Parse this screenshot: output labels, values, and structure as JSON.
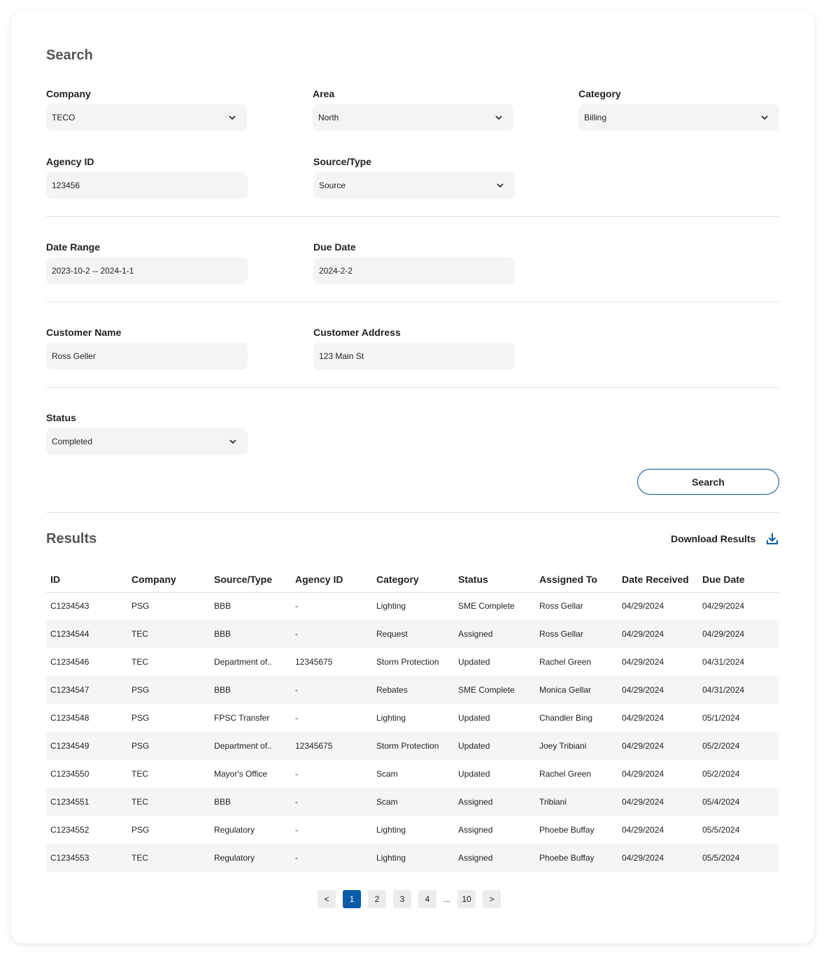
{
  "search": {
    "title": "Search",
    "company": {
      "label": "Company",
      "value": "TECO"
    },
    "area": {
      "label": "Area",
      "value": "North"
    },
    "category": {
      "label": "Category",
      "value": "Billing"
    },
    "agency_id": {
      "label": "Agency ID",
      "value": "123456"
    },
    "source_type": {
      "label": "Source/Type",
      "value": "Source"
    },
    "date_range": {
      "label": "Date Range",
      "value": "2023-10-2 -- 2024-1-1"
    },
    "due_date": {
      "label": "Due Date",
      "value": "2024-2-2"
    },
    "customer_name": {
      "label": "Customer Name",
      "value": "Ross Geller"
    },
    "customer_address": {
      "label": "Customer Address",
      "value": "123 Main St"
    },
    "status": {
      "label": "Status",
      "value": "Completed"
    },
    "button_label": "Search"
  },
  "results": {
    "title": "Results",
    "download_label": "Download Results",
    "columns": [
      "ID",
      "Company",
      "Source/Type",
      "Agency ID",
      "Category",
      "Status",
      "Assigned To",
      "Date Received",
      "Due Date"
    ],
    "rows": [
      [
        "C1234543",
        "PSG",
        "BBB",
        "-",
        "Lighting",
        "SME Complete",
        "Ross Gellar",
        "04/29/2024",
        "04/29/2024"
      ],
      [
        "C1234544",
        "TEC",
        "BBB",
        "-",
        "Request",
        "Assigned",
        "Ross Gellar",
        "04/29/2024",
        "04/29/2024"
      ],
      [
        "C1234546",
        "TEC",
        "Department of..",
        "12345675",
        "Storm Protection",
        "Updated",
        "Rachel Green",
        "04/29/2024",
        "04/31/2024"
      ],
      [
        "C1234547",
        "PSG",
        "BBB",
        "-",
        "Rebates",
        "SME Complete",
        "Monica Gellar",
        "04/29/2024",
        "04/31/2024"
      ],
      [
        "C1234548",
        "PSG",
        "FPSC Transfer",
        "-",
        "Lighting",
        "Updated",
        "Chandler Bing",
        "04/29/2024",
        "05/1/2024"
      ],
      [
        "C1234549",
        "PSG",
        "Department of..",
        "12345675",
        "Storm Protection",
        "Updated",
        "Joey Tribiani",
        "04/29/2024",
        "05/2/2024"
      ],
      [
        "C1234550",
        "TEC",
        "Mayor's Office",
        "-",
        "Scam",
        "Updated",
        "Rachel Green",
        "04/29/2024",
        "05/2/2024"
      ],
      [
        "C1234551",
        "TEC",
        "BBB",
        "-",
        "Scam",
        "Assigned",
        "Tribiani",
        "04/29/2024",
        "05/4/2024"
      ],
      [
        "C1234552",
        "PSG",
        "Regulatory",
        "-",
        "Lighting",
        "Assigned",
        "Phoebe Buffay",
        "04/29/2024",
        "05/5/2024"
      ],
      [
        "C1234553",
        "TEC",
        "Regulatory",
        "-",
        "Lighting",
        "Assigned",
        "Phoebe Buffay",
        "04/29/2024",
        "05/5/2024"
      ]
    ]
  },
  "pagination": {
    "prev": "<",
    "pages": [
      "1",
      "2",
      "3",
      "4"
    ],
    "ellipsis": "...",
    "last": "10",
    "next": ">",
    "current": "1"
  },
  "colors": {
    "accent": "#0b5ca8",
    "border_accent": "#0b4f9c"
  }
}
